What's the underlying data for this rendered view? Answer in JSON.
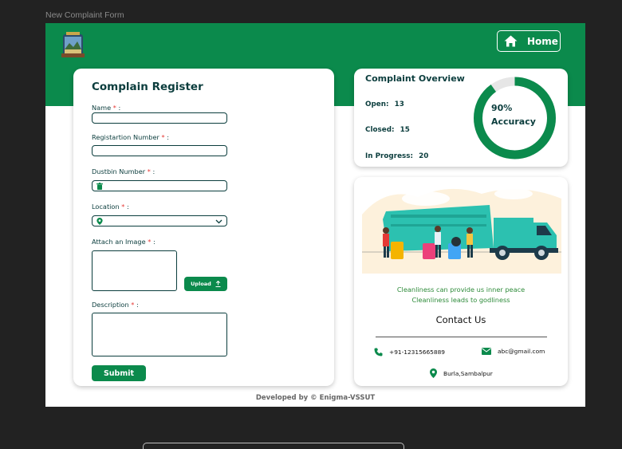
{
  "window": {
    "title": "New Complaint Form"
  },
  "header": {
    "home_label": "Home",
    "brand_color": "#0b8a4c",
    "home_icon": "home-icon",
    "logo_icon": "university-logo"
  },
  "form": {
    "title": "Complain Register",
    "fields": {
      "name": {
        "label": "Name",
        "value": ""
      },
      "registration": {
        "label": "Registartion Number",
        "value": ""
      },
      "dustbin": {
        "label": "Dustbin  Number",
        "value": "",
        "icon": "trash-icon"
      },
      "location": {
        "label": "Location",
        "value": "",
        "icon": "location-pin-icon"
      },
      "image": {
        "label": "Attach an Image",
        "upload_label": "Upload",
        "upload_icon": "upload-icon"
      },
      "description": {
        "label": "Description",
        "value": ""
      }
    },
    "required_marker": "*",
    "label_suffix": ":",
    "submit_label": "Submit"
  },
  "overview": {
    "title": "Complaint Overview",
    "open_label": "Open:",
    "open_value": "13",
    "closed_label": "Closed:",
    "closed_value": "15",
    "progress_label": "In Progress:",
    "progress_value": "20",
    "accuracy_value": "90%",
    "accuracy_label": "Accuracy",
    "accuracy_fraction": 0.9
  },
  "info": {
    "illustration": "garbage-truck-illustration",
    "quote1": "Cleanliness can provide us inner peace",
    "quote2": "Cleanliness leads to godliness",
    "contact_title": "Contact Us",
    "phone": "+91-12315665889",
    "email": "abc@gmail.com",
    "address": "Burla,Sambalpur",
    "phone_icon": "phone-icon",
    "email_icon": "mail-icon",
    "address_icon": "location-pin-icon"
  },
  "footer": {
    "text": "Developed by © Enigma-VSSUT"
  }
}
